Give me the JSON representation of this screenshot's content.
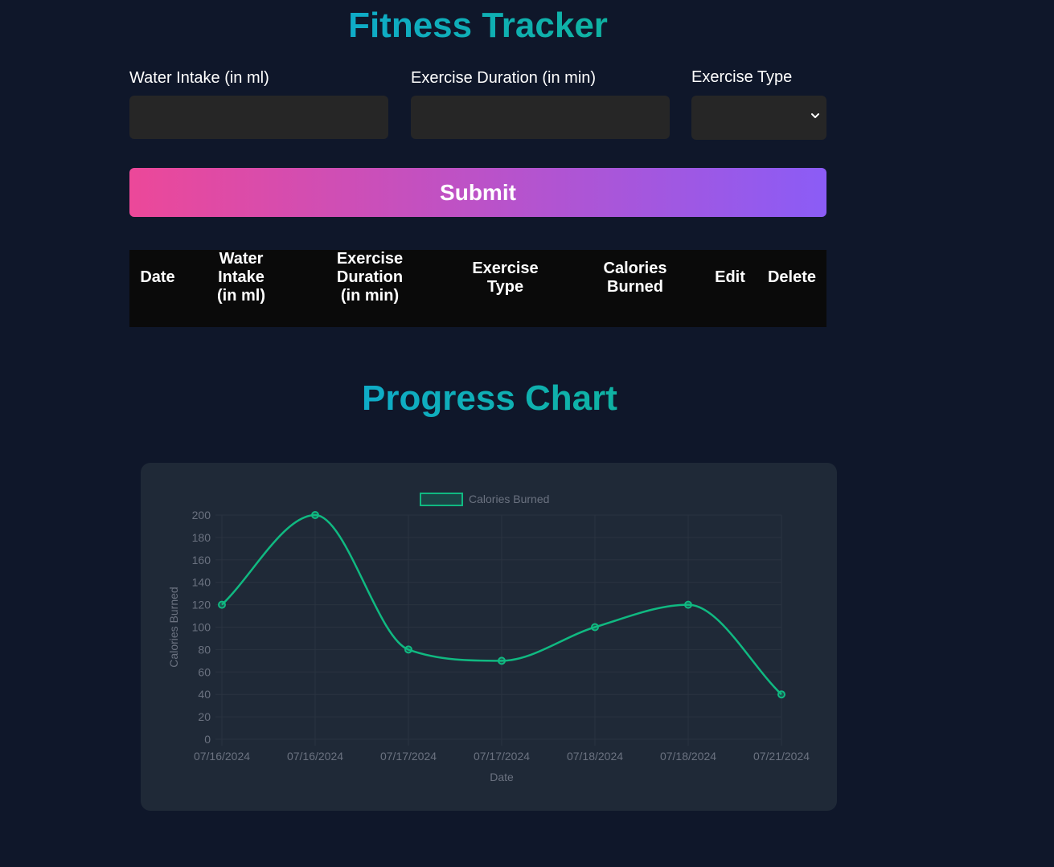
{
  "header": {
    "title": "Fitness Tracker"
  },
  "form": {
    "water_label": "Water Intake (in ml)",
    "water_value": "",
    "duration_label": "Exercise Duration (in min)",
    "duration_value": "",
    "type_label": "Exercise Type",
    "type_value": "",
    "submit_label": "Submit"
  },
  "table": {
    "headers": [
      "Date",
      "Water Intake (in ml)",
      "Exercise Duration (in min)",
      "Exercise Type",
      "Calories Burned",
      "Edit",
      "Delete"
    ],
    "rows": []
  },
  "chart_section": {
    "title": "Progress Chart"
  },
  "icons": {
    "select_arrow": "chevron-down-icon"
  },
  "colors": {
    "background": "#0f172a",
    "accent_line": "#10b981",
    "title_gradient_start": "#0ea5e9",
    "title_gradient_end": "#10b981",
    "button_gradient_start": "#ec4899",
    "button_gradient_end": "#8b5cf6",
    "card": "#1f2937",
    "input": "#262626"
  },
  "chart_data": {
    "type": "line",
    "categories": [
      "07/16/2024",
      "07/16/2024",
      "07/17/2024",
      "07/17/2024",
      "07/18/2024",
      "07/18/2024",
      "07/21/2024"
    ],
    "series": [
      {
        "name": "Calories Burned",
        "values": [
          120,
          200,
          80,
          70,
          100,
          120,
          40
        ]
      }
    ],
    "title": "",
    "xlabel": "Date",
    "ylabel": "Calories Burned",
    "ylim": [
      0,
      200
    ],
    "yticks": [
      0,
      20,
      40,
      60,
      80,
      100,
      120,
      140,
      160,
      180,
      200
    ],
    "grid": true,
    "legend": "top-center",
    "smooth": true
  }
}
